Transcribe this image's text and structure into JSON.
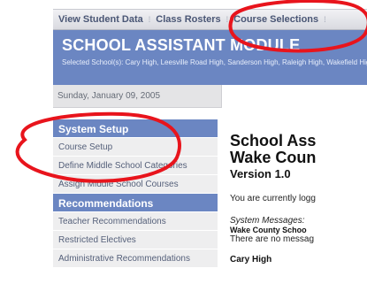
{
  "topnav": {
    "items": [
      "View Student Data",
      "Class Rosters",
      "Course Selections"
    ]
  },
  "header": {
    "title": "SCHOOL ASSISTANT MODULE",
    "schools": "Selected School(s): Cary High, Leesville Road High, Sanderson High, Raleigh High, Wakefield High"
  },
  "datebar": {
    "date": "Sunday, January 09, 2005"
  },
  "sidebar": {
    "sections": [
      {
        "header": "System Setup",
        "items": [
          "Course Setup",
          "Define Middle School Categories",
          "Assign Middle School Courses"
        ]
      },
      {
        "header": "Recommendations",
        "items": [
          "Teacher Recommendations",
          "Restricted Electives",
          "Administrative Recommendations"
        ]
      }
    ]
  },
  "main": {
    "title_line1": "School Ass",
    "title_line2": "Wake Coun",
    "version": "Version 1.0",
    "logged_in": "You are currently logg",
    "messages_label": "System Messages:",
    "messages_school": "Wake County Schoo",
    "messages_none": "There are no messag",
    "school_name": "Cary High"
  },
  "colors": {
    "accent_blue": "#6b86c2",
    "annotation_red": "#e8141c"
  }
}
